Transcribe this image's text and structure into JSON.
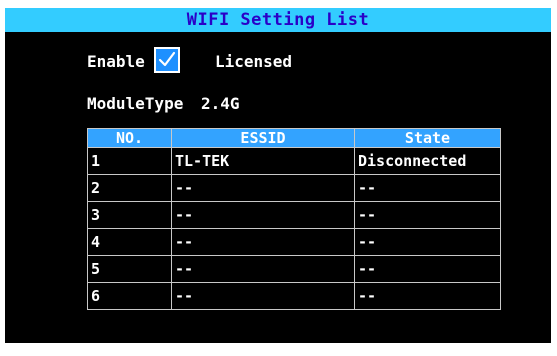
{
  "title": "WIFI Setting List",
  "enable": {
    "label": "Enable",
    "checked": true,
    "icon": "checkmark-icon"
  },
  "licensed": "Licensed",
  "module_type": {
    "label": "ModuleType",
    "value": "2.4G"
  },
  "table": {
    "columns": [
      "NO.",
      "ESSID",
      "State"
    ],
    "rows": [
      {
        "no": "1",
        "essid": "TL-TEK",
        "state": "Disconnected"
      },
      {
        "no": "2",
        "essid": "--",
        "state": "--"
      },
      {
        "no": "3",
        "essid": "--",
        "state": "--"
      },
      {
        "no": "4",
        "essid": "--",
        "state": "--"
      },
      {
        "no": "5",
        "essid": "--",
        "state": "--"
      },
      {
        "no": "6",
        "essid": "--",
        "state": "--"
      }
    ]
  },
  "colors": {
    "title_bar": "#33ccff",
    "title_text": "#2a00c8",
    "table_header": "#33a3ff",
    "checkbox": "#1e90ff",
    "background": "#000000"
  }
}
